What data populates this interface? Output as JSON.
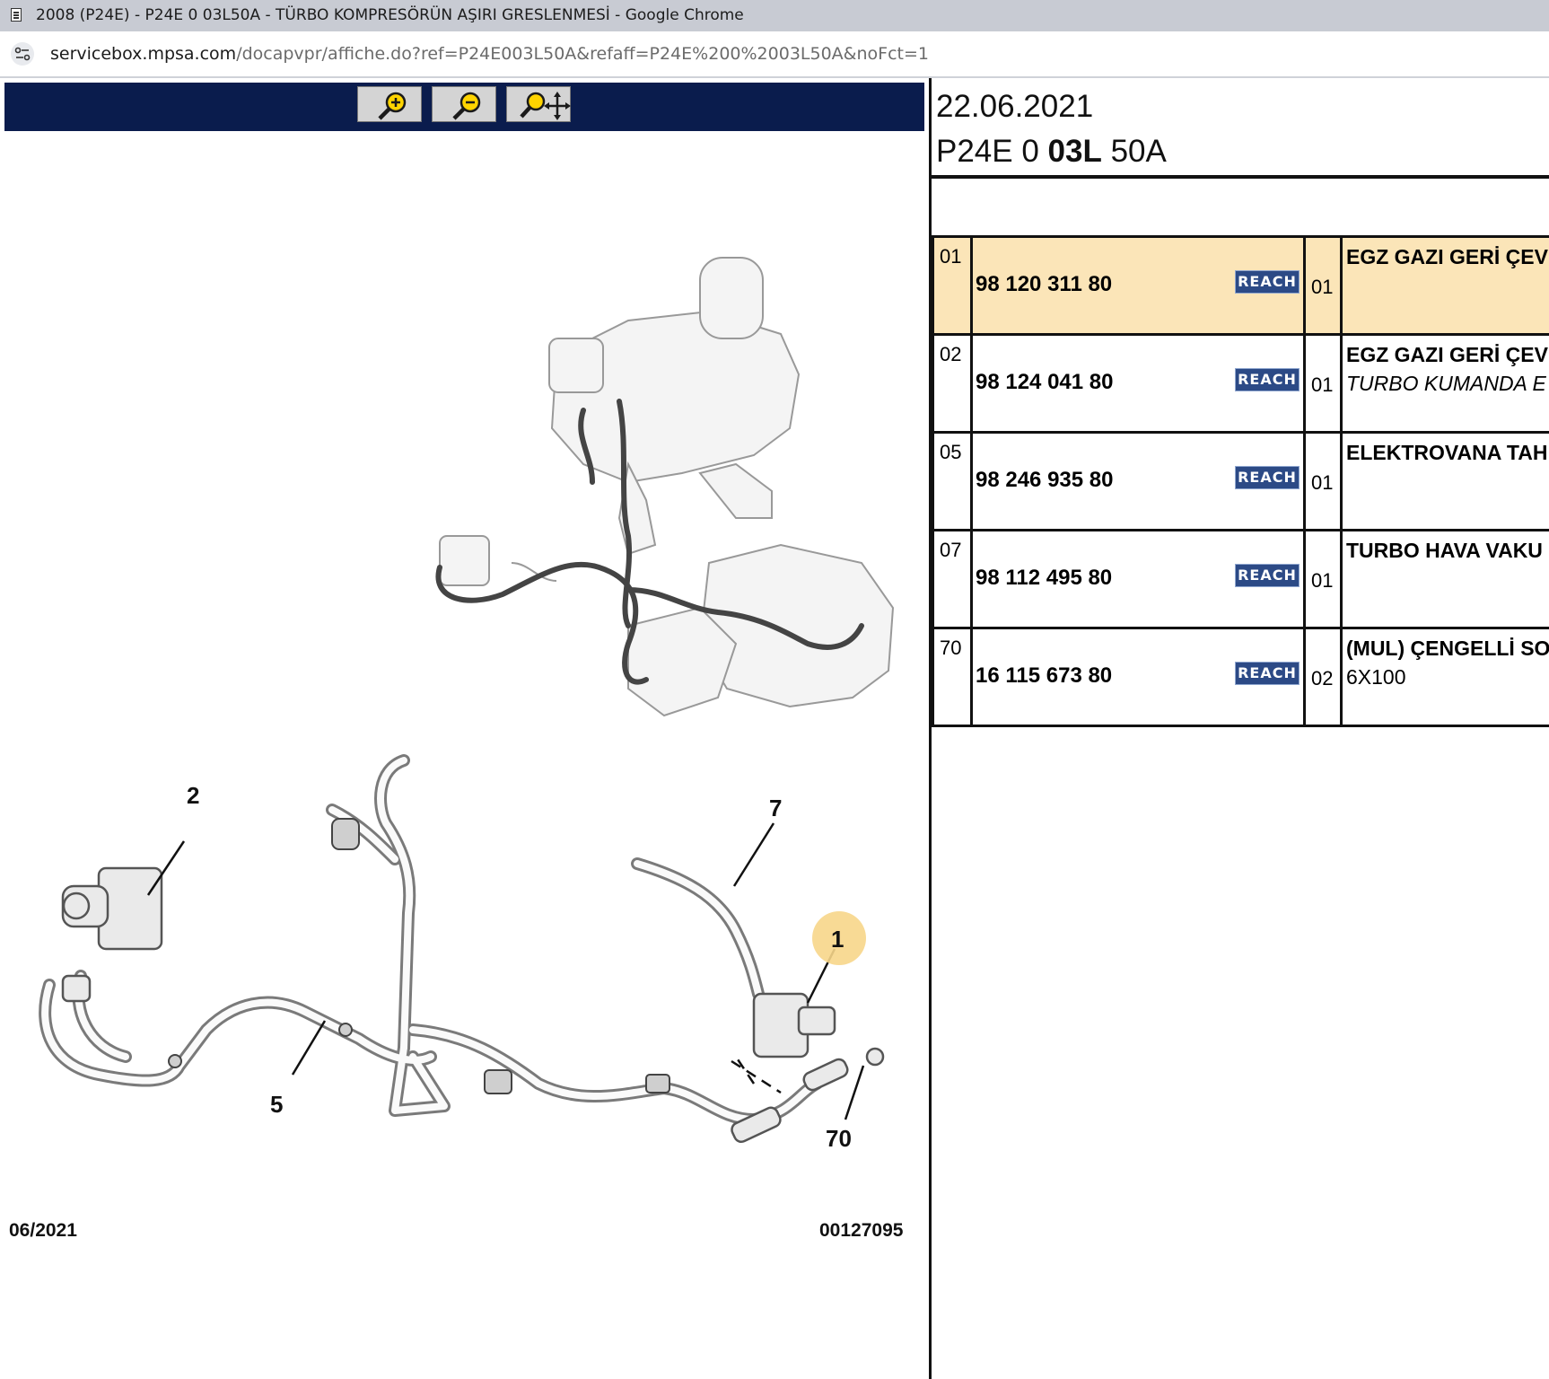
{
  "window": {
    "title": "2008 (P24E) - P24E 0 03L50A - TÜRBO KOMPRESÖRÜN AŞIRI GRESLENMESİ - Google Chrome"
  },
  "address_bar": {
    "host": "servicebox.mpsa.com",
    "path": "/docapvpr/affiche.do?ref=P24E003L50A&refaff=P24E%200%2003L50A&noFct=1"
  },
  "toolbar": {
    "buttons": [
      "zoom-in-icon",
      "zoom-out-icon",
      "zoom-pan-icon"
    ]
  },
  "diagram": {
    "callouts": [
      "2",
      "7",
      "1",
      "5",
      "70"
    ],
    "highlight_color": "#f7d68a",
    "footer_date": "06/2021",
    "footer_code": "00127095"
  },
  "header": {
    "date": "22.06.2021",
    "ref_prefix": "P24E 0 ",
    "ref_bold": "03L",
    "ref_suffix": " 50A"
  },
  "parts": [
    {
      "idx": "01",
      "ref": "98 120 311 80",
      "badge": "REACH",
      "qty": "01",
      "desc1": "EGZ GAZI GERİ ÇEV",
      "desc2": "",
      "selected": true
    },
    {
      "idx": "02",
      "ref": "98 124 041 80",
      "badge": "REACH",
      "qty": "01",
      "desc1": "EGZ GAZI GERİ ÇEV",
      "desc2": "TURBO KUMANDA E",
      "selected": false
    },
    {
      "idx": "05",
      "ref": "98 246 935 80",
      "badge": "REACH",
      "qty": "01",
      "desc1": "ELEKTROVANA TAH",
      "desc2": "",
      "selected": false
    },
    {
      "idx": "07",
      "ref": "98 112 495 80",
      "badge": "REACH",
      "qty": "01",
      "desc1": "TURBO HAVA VAKU",
      "desc2": "",
      "selected": false
    },
    {
      "idx": "70",
      "ref": "16 115 673 80",
      "badge": "REACH",
      "qty": "02",
      "desc1": "(MUL) ÇENGELLİ SO",
      "desc2": "6X100",
      "selected": false
    }
  ],
  "colors": {
    "toolbar": "#0a1c4d",
    "reach_badge": "#2c4a86",
    "selected_row": "#fbe5b8"
  }
}
